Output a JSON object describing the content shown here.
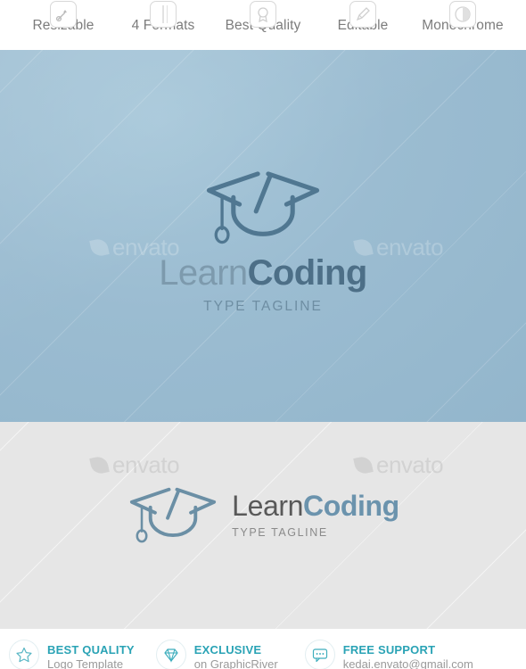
{
  "features": [
    {
      "label": "Resizable",
      "icon": "resize-arrow-icon"
    },
    {
      "label": "4 Formats",
      "icon": "file-formats-icon"
    },
    {
      "label": "Best Quality",
      "icon": "quality-badge-icon"
    },
    {
      "label": "Editable",
      "icon": "pencil-edit-icon"
    },
    {
      "label": "Monochrome",
      "icon": "monochrome-circle-icon"
    }
  ],
  "logo": {
    "icon": "graduation-cap-code-icon",
    "name_part1": "Learn",
    "name_part2": "Coding",
    "tagline": "TYPE TAGLINE"
  },
  "watermark": {
    "text": "envato",
    "icon": "envato-leaf-icon"
  },
  "footer": {
    "items": [
      {
        "icon": "star-icon",
        "title": "BEST QUALITY",
        "subtitle": "Logo Template"
      },
      {
        "icon": "diamond-icon",
        "title": "EXCLUSIVE",
        "subtitle": "on GraphicRiver"
      },
      {
        "icon": "chat-bubble-icon",
        "title": "FREE SUPPORT",
        "subtitle": "kedai.envato@gmail.com"
      }
    ]
  },
  "colors": {
    "panel_blue": "#9bbcd1",
    "panel_gray": "#e6e6e6",
    "logo_blue_dark": "#4d6f87",
    "logo_blue_light": "#7d9aad",
    "logo_row_dark": "#595959",
    "logo_row_blue": "#6b93ad",
    "footer_teal": "#2aa3b5",
    "footer_gray": "#9a9a9a",
    "feature_label": "#7c7c7c"
  }
}
